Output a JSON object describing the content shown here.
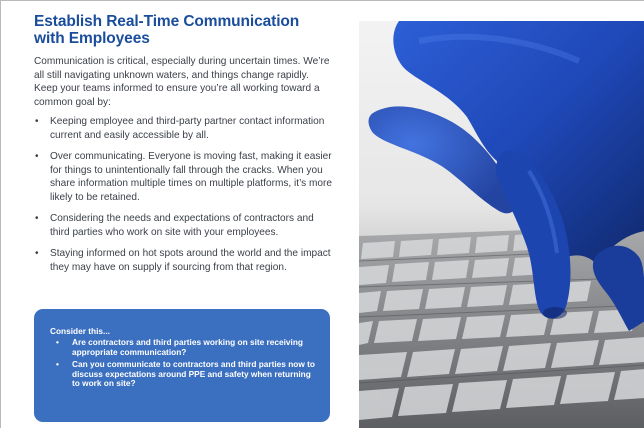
{
  "document": {
    "title_line1": "Establish Real-Time Communication",
    "title_line2": "with Employees",
    "intro": "Communication is critical, especially during uncertain times. We’re all still navigating unknown waters, and things change rapidly. Keep your teams informed to ensure you’re all working toward a common goal by:",
    "bullet_marker": "•",
    "bullets": [
      "Keeping employee and third-party partner contact information current and easily accessible by all.",
      "Over communicating. Everyone is moving fast, making it easier for things to unintentionally fall through the cracks. When you share information multiple times on multiple platforms, it’s more likely to be retained.",
      "Considering the needs and expectations of contractors and third parties who work on site with your employees.",
      "Staying informed on hot spots around the world and the impact they may have on supply if sourcing from that region."
    ],
    "callout": {
      "heading": "Consider this...",
      "items": [
        "Are contractors and third parties working on site receiving appropriate communication?",
        "Can you communicate to contractors and third parties now to discuss expectations around PPE and safety when returning to work on site?"
      ]
    }
  },
  "photo": {
    "subject": "gloved-hand-on-keyboard-photo"
  },
  "colors": {
    "title": "#1a4d9c",
    "callout_bg": "#3b6fbf",
    "body_text": "#3a3f47",
    "glove": "#1f48b8"
  }
}
